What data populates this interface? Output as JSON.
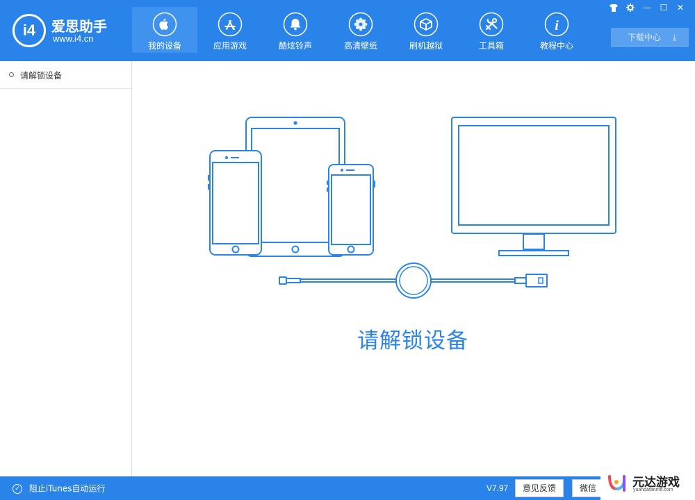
{
  "app": {
    "logo_text": "i4",
    "name": "爱思助手",
    "url": "www.i4.cn"
  },
  "nav": [
    {
      "label": "我的设备",
      "icon": "apple-icon",
      "active": true
    },
    {
      "label": "应用游戏",
      "icon": "app-store-icon",
      "active": false
    },
    {
      "label": "酷炫铃声",
      "icon": "bell-icon",
      "active": false
    },
    {
      "label": "高清壁纸",
      "icon": "flower-icon",
      "active": false
    },
    {
      "label": "刷机越狱",
      "icon": "box-icon",
      "active": false
    },
    {
      "label": "工具箱",
      "icon": "tools-icon",
      "active": false
    },
    {
      "label": "教程中心",
      "icon": "info-icon",
      "active": false
    }
  ],
  "window_controls": {
    "skin": "shirt-icon",
    "settings": "gear-icon",
    "minimize": "—",
    "maximize": "☐",
    "close": "✕"
  },
  "download_center": {
    "label": "下载中心",
    "icon": "download-icon"
  },
  "sidebar": {
    "items": [
      {
        "label": "请解锁设备"
      }
    ]
  },
  "main": {
    "message": "请解锁设备",
    "illustration": [
      "iphone-icon",
      "ipad-icon",
      "iphone-small-icon",
      "monitor-icon",
      "usb-cable-icon"
    ]
  },
  "statusbar": {
    "itunes_label": "阻止iTunes自动运行",
    "itunes_icon": "✓",
    "version": "V7.97",
    "feedback_label": "意见反馈",
    "wechat_label": "微信"
  },
  "watermark": {
    "title": "元达游戏",
    "subtitle": "yuandafanmd.com"
  },
  "colors": {
    "brand_blue": "#2a83e8",
    "nav_active": "#3f93ee",
    "illustration_stroke": "#2a83e8"
  }
}
